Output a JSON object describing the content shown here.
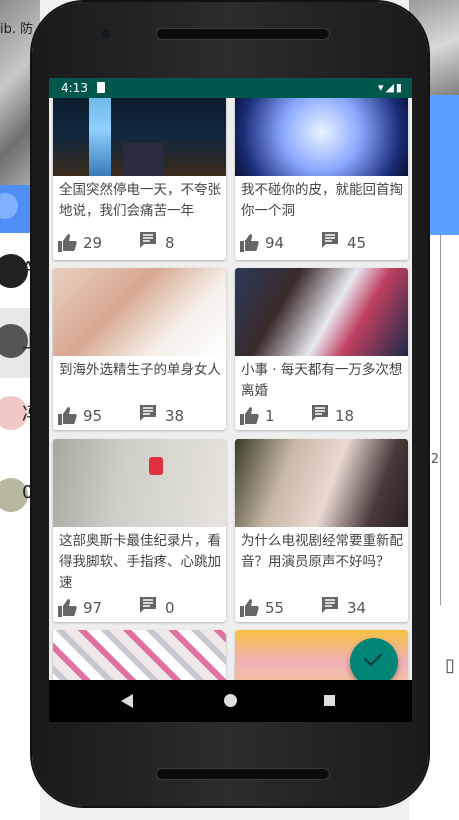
{
  "desktop": {
    "top_text": "ib.   防",
    "left_items": [
      "A",
      "上",
      "冯",
      "0"
    ],
    "right_label": "2"
  },
  "status_bar": {
    "time": "4:13",
    "icons": "▾◢▮"
  },
  "cards": [
    {
      "title": "全国突然停电一天，不夸张地说，我们会痛苦一年",
      "likes": "29",
      "comments": "8"
    },
    {
      "title": "我不碰你的皮，就能回首掏你一个洞",
      "likes": "94",
      "comments": "45"
    },
    {
      "title": "到海外选精生子的单身女人",
      "likes": "95",
      "comments": "38"
    },
    {
      "title": "小事 · 每天都有一万多次想离婚",
      "likes": "1",
      "comments": "18"
    },
    {
      "title": "这部奥斯卡最佳纪录片，看得我脚软、手指疼、心跳加速",
      "likes": "97",
      "comments": "0"
    },
    {
      "title": "为什么电视剧经常要重新配音？用演员原声不好吗？",
      "likes": "55",
      "comments": "34"
    },
    {
      "title": "",
      "likes": "",
      "comments": ""
    },
    {
      "title": "",
      "likes": "",
      "comments": ""
    }
  ],
  "icons": {
    "like": "thumb-up-icon",
    "comment": "comment-icon",
    "fab": "check-icon"
  },
  "colors": {
    "status_bar": "#00574b",
    "fab": "#008577",
    "text": "#444444"
  }
}
